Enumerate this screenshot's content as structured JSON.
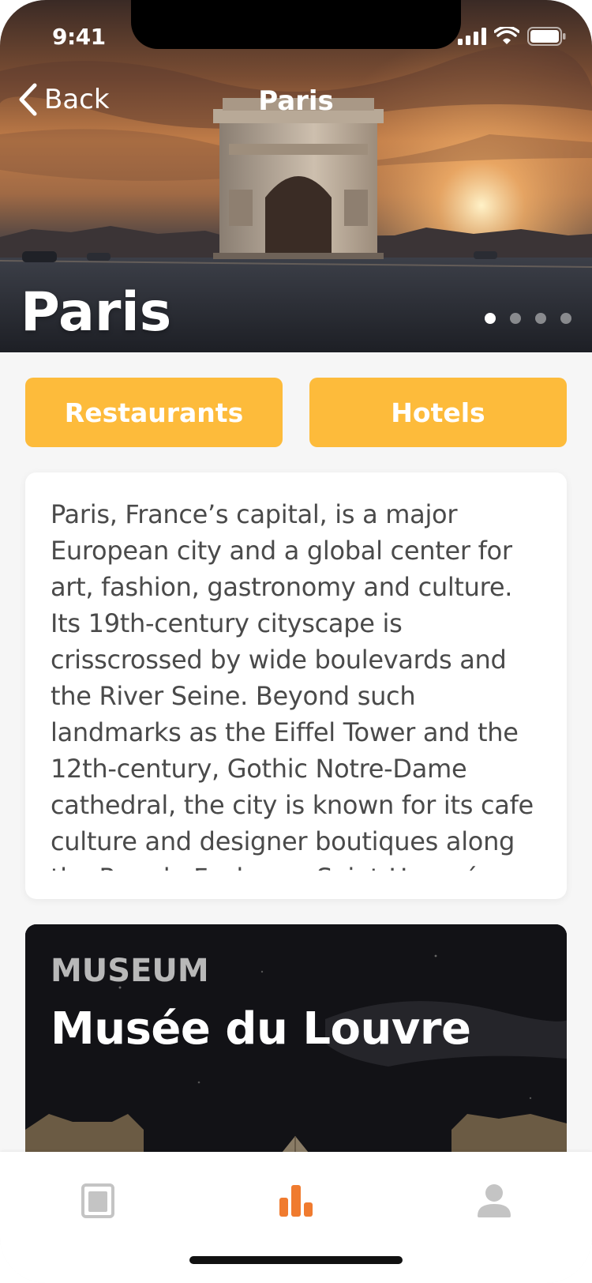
{
  "status_bar": {
    "time": "9:41"
  },
  "nav": {
    "back_label": "Back",
    "title": "Paris"
  },
  "hero": {
    "title": "Paris",
    "pager": {
      "count": 4,
      "active_index": 0
    }
  },
  "actions": {
    "restaurants_label": "Restaurants",
    "hotels_label": "Hotels"
  },
  "description": {
    "text": "Paris, France’s capital, is a major European city and a global center for art, fashion, gastronomy and culture. Its 19th-century cityscape is crisscrossed by wide boulevards and the River Seine. Beyond such landmarks as the Eiffel Tower and the 12th-century, Gothic Notre-Dame cathedral, the city is known for its cafe culture and designer boutiques along the Rue du Faubourg Saint-Honoré."
  },
  "featured": {
    "category": "MUSEUM",
    "name": "Musée du Louvre"
  },
  "tab_bar": {
    "tabs": [
      {
        "icon": "newspaper-icon",
        "active": false
      },
      {
        "icon": "bar-chart-icon",
        "active": true
      },
      {
        "icon": "user-icon",
        "active": false
      }
    ]
  },
  "colors": {
    "accent": "#fdbb3b",
    "active_tab": "#f07b2f",
    "inactive_tab": "#c4c4c4"
  }
}
